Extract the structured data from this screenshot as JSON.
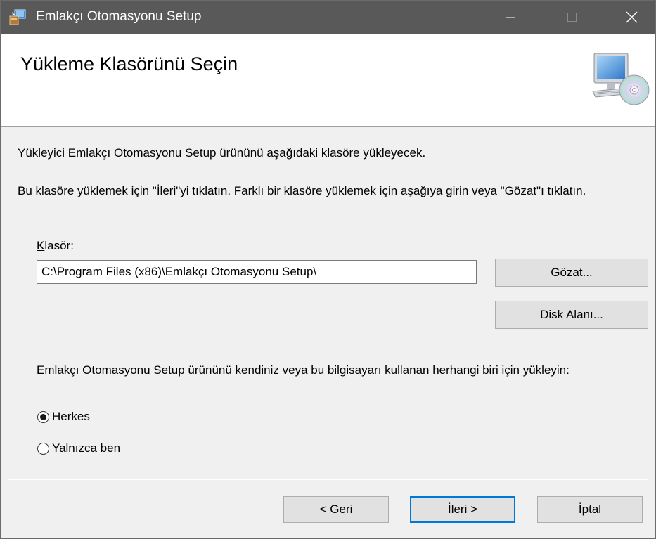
{
  "window": {
    "title": "Emlakçı Otomasyonu Setup",
    "app_icon": "installer-icon",
    "controls": {
      "minimize": "minimize-icon",
      "maximize": "maximize-icon",
      "close": "close-icon"
    }
  },
  "banner": {
    "heading": "Yükleme Klasörünü Seçin",
    "icon": "computer-cd-icon"
  },
  "content": {
    "intro": "Yükleyici Emlakçı Otomasyonu Setup ürününü aşağıdaki klasöre yükleyecek.",
    "instructions": "Bu klasöre yüklemek için \"İleri\"yi tıklatın. Farklı bir klasöre yüklemek için aşağıya girin veya \"Gözat\"ı tıklatın.",
    "folder_label_accel": "K",
    "folder_label_rest": "lasör:",
    "folder_value": "C:\\Program Files (x86)\\Emlakçı Otomasyonu Setup\\",
    "browse_label": "Gözat...",
    "disk_label": "Disk Alanı...",
    "scope_prompt": "Emlakçı Otomasyonu Setup ürününü kendiniz veya bu bilgisayarı kullanan herhangi biri için yükleyin:",
    "radio_everyone": "Herkes",
    "radio_just_me": "Yalnızca ben",
    "selected_scope": "Herkes"
  },
  "footer": {
    "back_label": "< Geri",
    "next_label": "İleri >",
    "cancel_label": "İptal"
  },
  "colors": {
    "titlebar": "#595959",
    "dialog_bg": "#f0f0f0",
    "banner_bg": "#ffffff",
    "button_bg": "#e1e1e1",
    "default_button_border": "#0078d7"
  }
}
